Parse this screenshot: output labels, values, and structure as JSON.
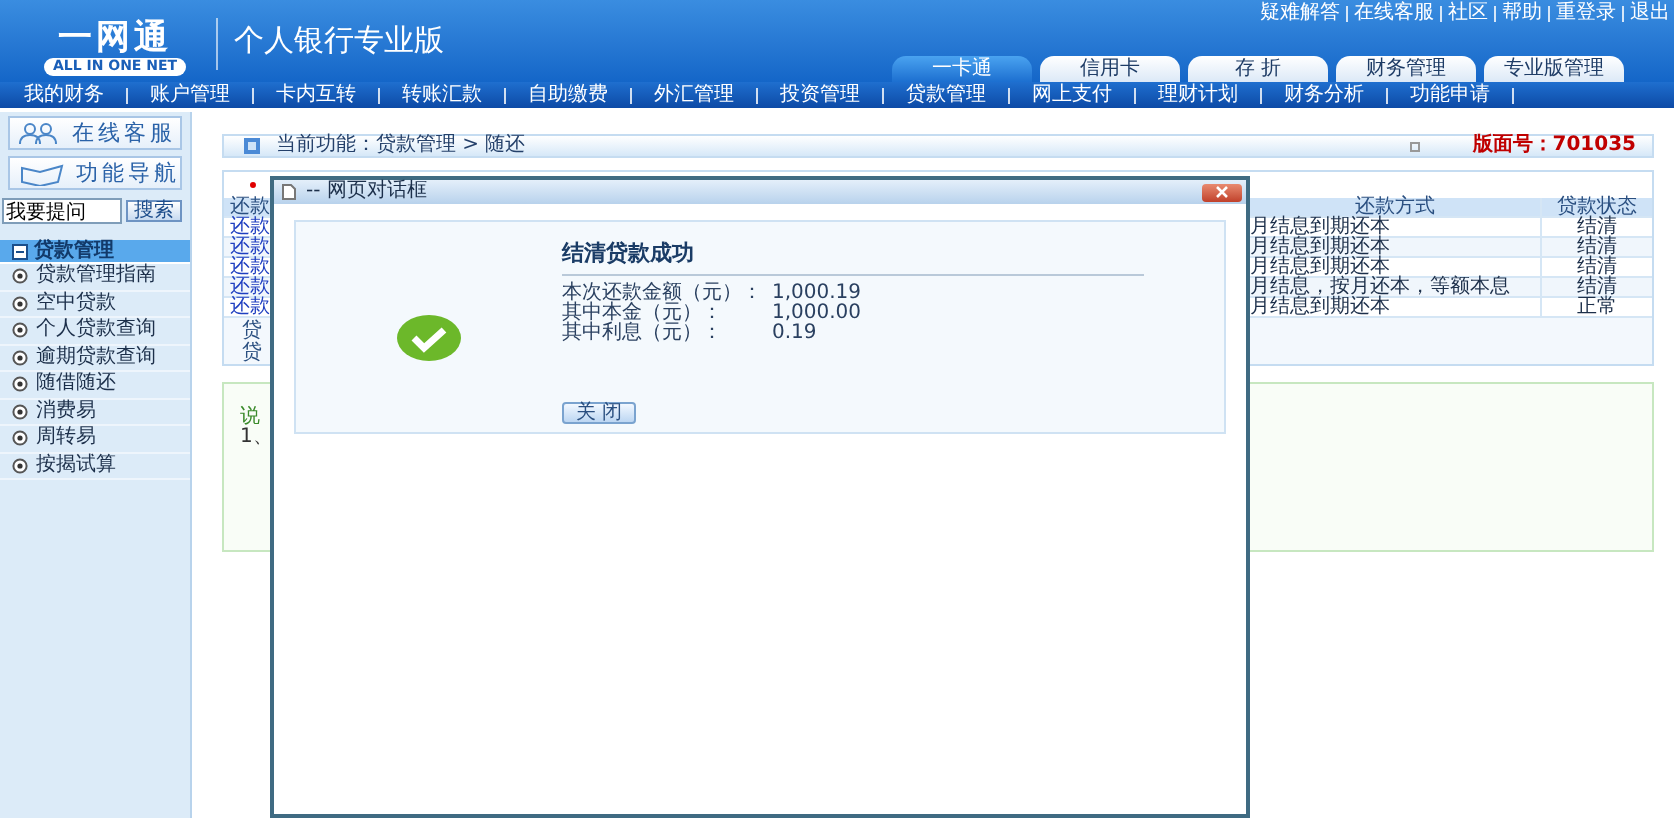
{
  "header": {
    "logo": {
      "mark": "一网通",
      "subtitle": "ALL IN ONE NET"
    },
    "title": "个人银行专业版",
    "top_links": [
      "疑难解答",
      "在线客服",
      "社区",
      "帮助",
      "重登录",
      "退出"
    ],
    "tabs": [
      {
        "label": "一卡通",
        "selected": true
      },
      {
        "label": "信用卡",
        "selected": false
      },
      {
        "label": "存 折",
        "selected": false
      },
      {
        "label": "财务管理",
        "selected": false
      },
      {
        "label": "专业版管理",
        "selected": false
      }
    ]
  },
  "nav": [
    "我的财务",
    "账户管理",
    "卡内互转",
    "转账汇款",
    "自助缴费",
    "外汇管理",
    "投资管理",
    "贷款管理",
    "网上支付",
    "理财计划",
    "财务分析",
    "功能申请"
  ],
  "sidebar": {
    "buttons": [
      {
        "kind": "people",
        "label": "在线客服"
      },
      {
        "kind": "book",
        "label": "功能导航"
      }
    ],
    "search": {
      "value": "我要提问",
      "button": "搜索"
    },
    "menu": {
      "title": "贷款管理",
      "items": [
        {
          "label": "贷款管理指南"
        },
        {
          "label": "空中贷款"
        },
        {
          "label": "个人贷款查询"
        },
        {
          "label": "逾期贷款查询"
        },
        {
          "label": "随借随还"
        },
        {
          "label": "消费易"
        },
        {
          "label": "周转易"
        },
        {
          "label": "按揭试算"
        }
      ]
    }
  },
  "breadcrumb": {
    "text": "当前功能：贷款管理 > 随还",
    "page_no": "版面号：701035"
  },
  "table": {
    "columns": [
      "还款",
      "还款方式",
      "贷款状态"
    ],
    "rows": [
      [
        "还款",
        "月结息到期还本",
        "结清"
      ],
      [
        "还款",
        "月结息到期还本",
        "结清"
      ],
      [
        "还款",
        "月结息到期还本",
        "结清"
      ],
      [
        "还款",
        "月结息，按月还本，等额本息",
        "结清"
      ],
      [
        "还款",
        "月结息到期还本",
        "正常"
      ]
    ],
    "footer_lines": [
      "贷",
      "贷"
    ]
  },
  "note": {
    "title": "说",
    "lines": [
      "1、"
    ]
  },
  "dialog": {
    "title": "-- 网页对话框",
    "heading": "结清贷款成功",
    "fields": [
      {
        "label": "本次还款金额（元）：",
        "value": "1,000.19"
      },
      {
        "label": "其中本金（元）：",
        "value": "1,000.00"
      },
      {
        "label": "其中利息（元）：",
        "value": "0.19"
      }
    ],
    "button": "关 闭"
  }
}
